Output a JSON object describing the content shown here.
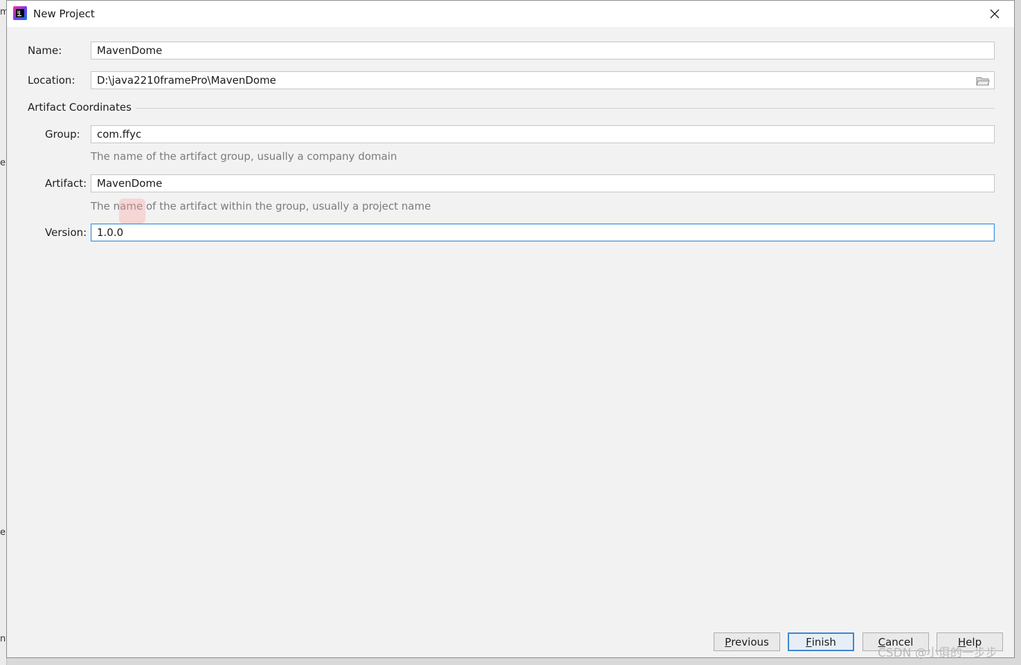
{
  "window": {
    "title": "New Project",
    "close_icon": "close-icon",
    "app_icon": "intellij-app-icon"
  },
  "form": {
    "name": {
      "label": "Name:",
      "value": "MavenDome"
    },
    "location": {
      "label": "Location:",
      "value": "D:\\java2210framePro\\MavenDome",
      "browse_icon": "folder-icon"
    },
    "section_title": "Artifact Coordinates",
    "group": {
      "label": "Group:",
      "value": "com.ffyc",
      "hint": "The name of the artifact group, usually a company domain"
    },
    "artifact": {
      "label": "Artifact:",
      "value": "MavenDome",
      "hint": "The name of the artifact within the group, usually a project name"
    },
    "version": {
      "label": "Version:",
      "value": "1.0.0"
    }
  },
  "buttons": {
    "previous": {
      "mnemonic": "P",
      "rest": "revious"
    },
    "finish": {
      "mnemonic": "F",
      "rest": "inish"
    },
    "cancel": {
      "mnemonic": "C",
      "rest": "ancel"
    },
    "help": {
      "mnemonic": "H",
      "rest": "elp"
    }
  },
  "background_glyphs": [
    "m",
    "e",
    "e:",
    "nt"
  ],
  "watermark": "CSDN @小俱的一步步",
  "colors": {
    "focus": "#3b8fd9",
    "hint": "#7b7b7b",
    "dialog_bg": "#f2f2f2"
  }
}
